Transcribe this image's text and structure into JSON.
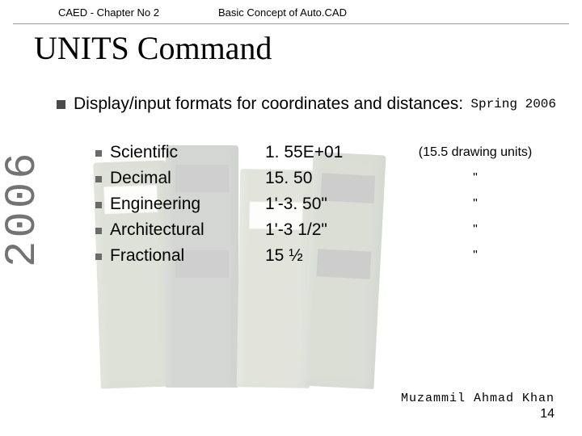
{
  "header": {
    "left": "CAED - Chapter No 2",
    "right": "Basic Concept of Auto.CAD"
  },
  "title": "UNITS Command",
  "semester": "Spring 2006",
  "side_year": "2006",
  "intro": "Display/input formats for coordinates and distances:",
  "formats": [
    {
      "name": "Scientific",
      "example": "1. 55E+01",
      "note": "(15.5 drawing units)"
    },
    {
      "name": "Decimal",
      "example": "15. 50",
      "note": "\""
    },
    {
      "name": "Engineering",
      "example": "1'-3. 50\"",
      "note": "\""
    },
    {
      "name": "Architectural",
      "example": "1'-3 1/2\"",
      "note": "\""
    },
    {
      "name": "Fractional",
      "example": "15 ½",
      "note": "\""
    }
  ],
  "footer": {
    "author": "Muzammil Ahmad Khan",
    "page": "14"
  }
}
